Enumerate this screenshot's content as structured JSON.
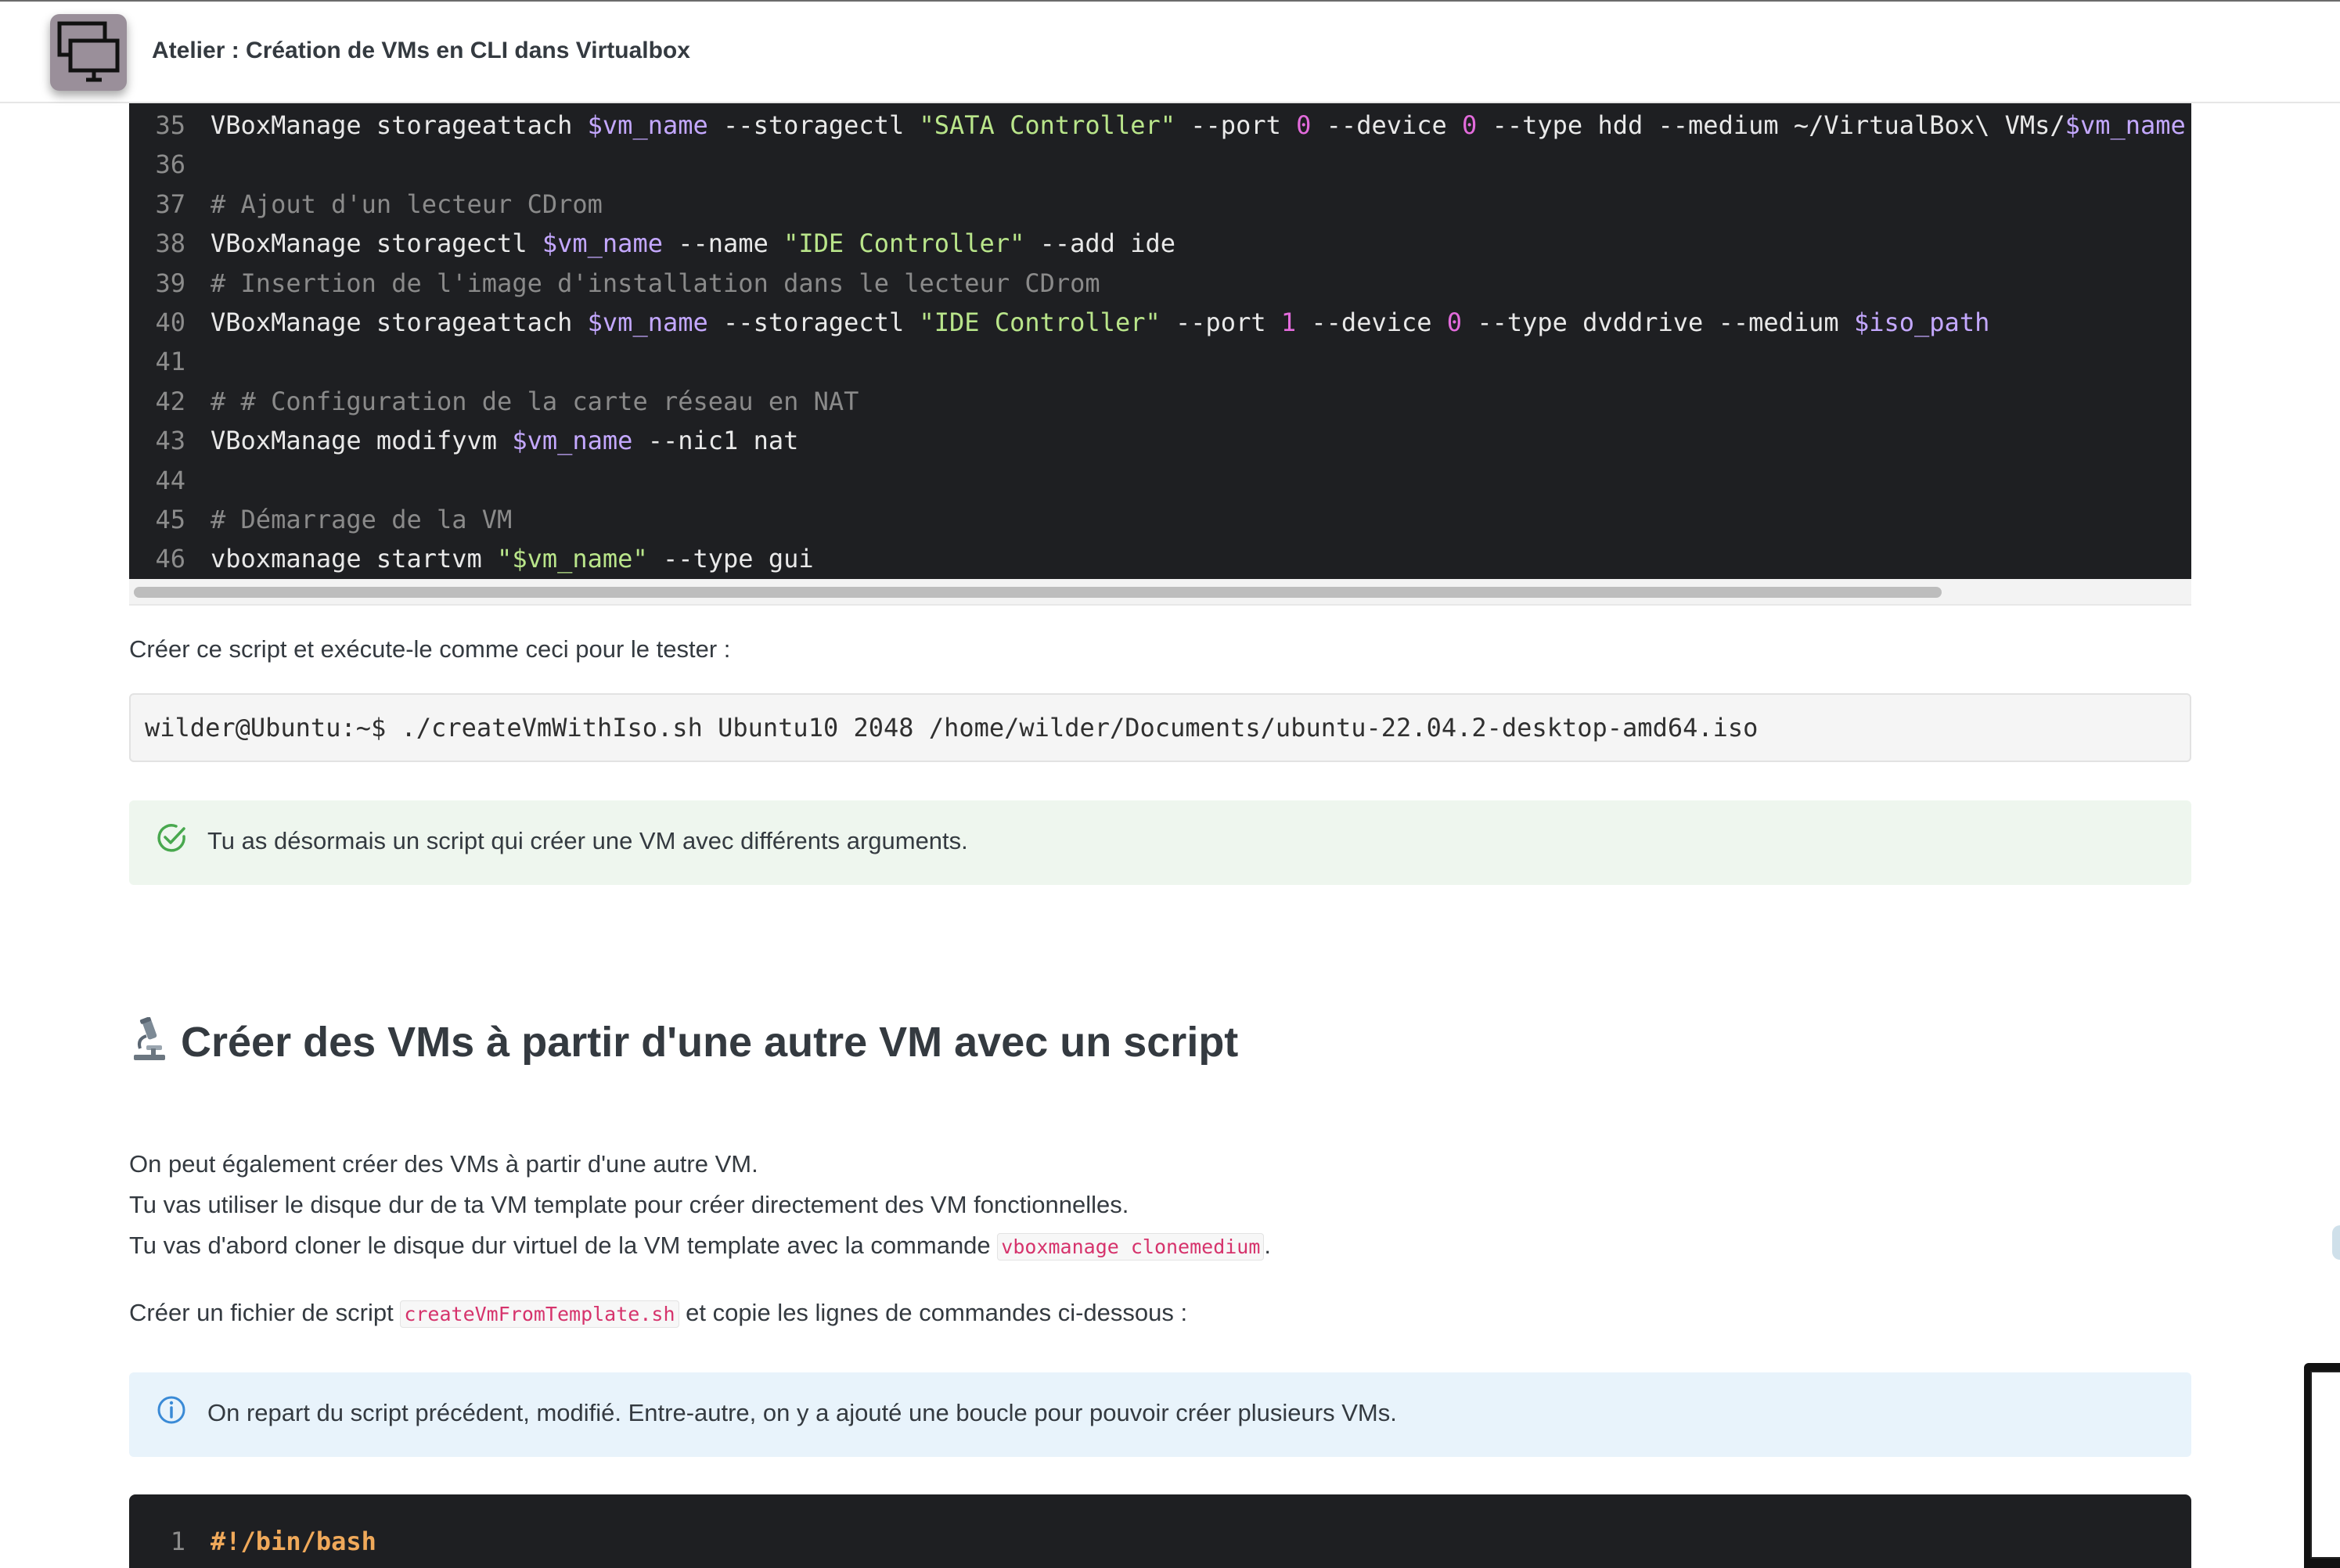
{
  "header": {
    "title": "Atelier : Création de VMs en CLI dans Virtualbox",
    "logo_icon": "monitor-windows-icon"
  },
  "code_block_1": {
    "lines": [
      {
        "n": "35",
        "segs": [
          [
            "t",
            "VBoxManage storageattach "
          ],
          [
            "v",
            "$vm_name"
          ],
          [
            "t",
            " --storagectl "
          ],
          [
            "s",
            "\"SATA Controller\""
          ],
          [
            "t",
            " --port "
          ],
          [
            "n",
            "0"
          ],
          [
            "t",
            " --device "
          ],
          [
            "n",
            "0"
          ],
          [
            "t",
            " --type hdd --medium ~/VirtualBox\\ VMs/"
          ],
          [
            "v",
            "$vm_name"
          ]
        ]
      },
      {
        "n": "36",
        "segs": []
      },
      {
        "n": "37",
        "segs": [
          [
            "c",
            "# Ajout d'un lecteur CDrom"
          ]
        ]
      },
      {
        "n": "38",
        "segs": [
          [
            "t",
            "VBoxManage storagectl "
          ],
          [
            "v",
            "$vm_name"
          ],
          [
            "t",
            " --name "
          ],
          [
            "s",
            "\"IDE Controller\""
          ],
          [
            "t",
            " --add ide"
          ]
        ]
      },
      {
        "n": "39",
        "segs": [
          [
            "c",
            "# Insertion de l'image d'installation dans le lecteur CDrom"
          ]
        ]
      },
      {
        "n": "40",
        "segs": [
          [
            "t",
            "VBoxManage storageattach "
          ],
          [
            "v",
            "$vm_name"
          ],
          [
            "t",
            " --storagectl "
          ],
          [
            "s",
            "\"IDE Controller\""
          ],
          [
            "t",
            " --port "
          ],
          [
            "n",
            "1"
          ],
          [
            "t",
            " --device "
          ],
          [
            "n",
            "0"
          ],
          [
            "t",
            " --type dvddrive --medium "
          ],
          [
            "v",
            "$iso_path"
          ]
        ]
      },
      {
        "n": "41",
        "segs": []
      },
      {
        "n": "42",
        "segs": [
          [
            "c",
            "# # Configuration de la carte réseau en NAT"
          ]
        ]
      },
      {
        "n": "43",
        "segs": [
          [
            "t",
            "VBoxManage modifyvm "
          ],
          [
            "v",
            "$vm_name"
          ],
          [
            "t",
            " --nic1 nat"
          ]
        ]
      },
      {
        "n": "44",
        "segs": []
      },
      {
        "n": "45",
        "segs": [
          [
            "c",
            "# Démarrage de la VM"
          ]
        ]
      },
      {
        "n": "46",
        "segs": [
          [
            "t",
            "vboxmanage startvm "
          ],
          [
            "s",
            "\"$vm_name\""
          ],
          [
            "t",
            " --type gui"
          ]
        ]
      }
    ]
  },
  "content": {
    "p_run": "Créer ce script et exécute-le comme ceci pour le tester :",
    "cmd": "wilder@Ubuntu:~$ ./createVmWithIso.sh Ubuntu10 2048 /home/wilder/Documents/ubuntu-22.04.2-desktop-amd64.iso",
    "success": {
      "icon": "check-circle-icon",
      "text": "Tu as désormais un script qui créer une VM avec différents arguments."
    },
    "section_title": "Créer des VMs à partir d'une autre VM avec un script",
    "section_icon": "microscope-icon",
    "para1": "On peut également créer des VMs à partir d'une autre VM.",
    "para2": "Tu vas utiliser le disque dur de ta VM template pour créer directement des VM fonctionnelles.",
    "para3_prefix": "Tu vas d'abord cloner le disque dur virtuel de la VM template avec la commande ",
    "para3_code": "vboxmanage clonemedium",
    "para3_suffix": ".",
    "para4_prefix": "Créer un fichier de script ",
    "para4_code": "createVmFromTemplate.sh",
    "para4_suffix": " et copie les lignes de commandes ci-dessous :",
    "info": {
      "icon": "info-circle-icon",
      "text": "On repart du script précédent, modifié. Entre-autre, on y a ajouté une boucle pour pouvoir créer plusieurs VMs."
    }
  },
  "code_block_2": {
    "lines": [
      {
        "n": "1",
        "segs": [
          [
            "k",
            "#!/bin/bash"
          ]
        ]
      }
    ]
  }
}
